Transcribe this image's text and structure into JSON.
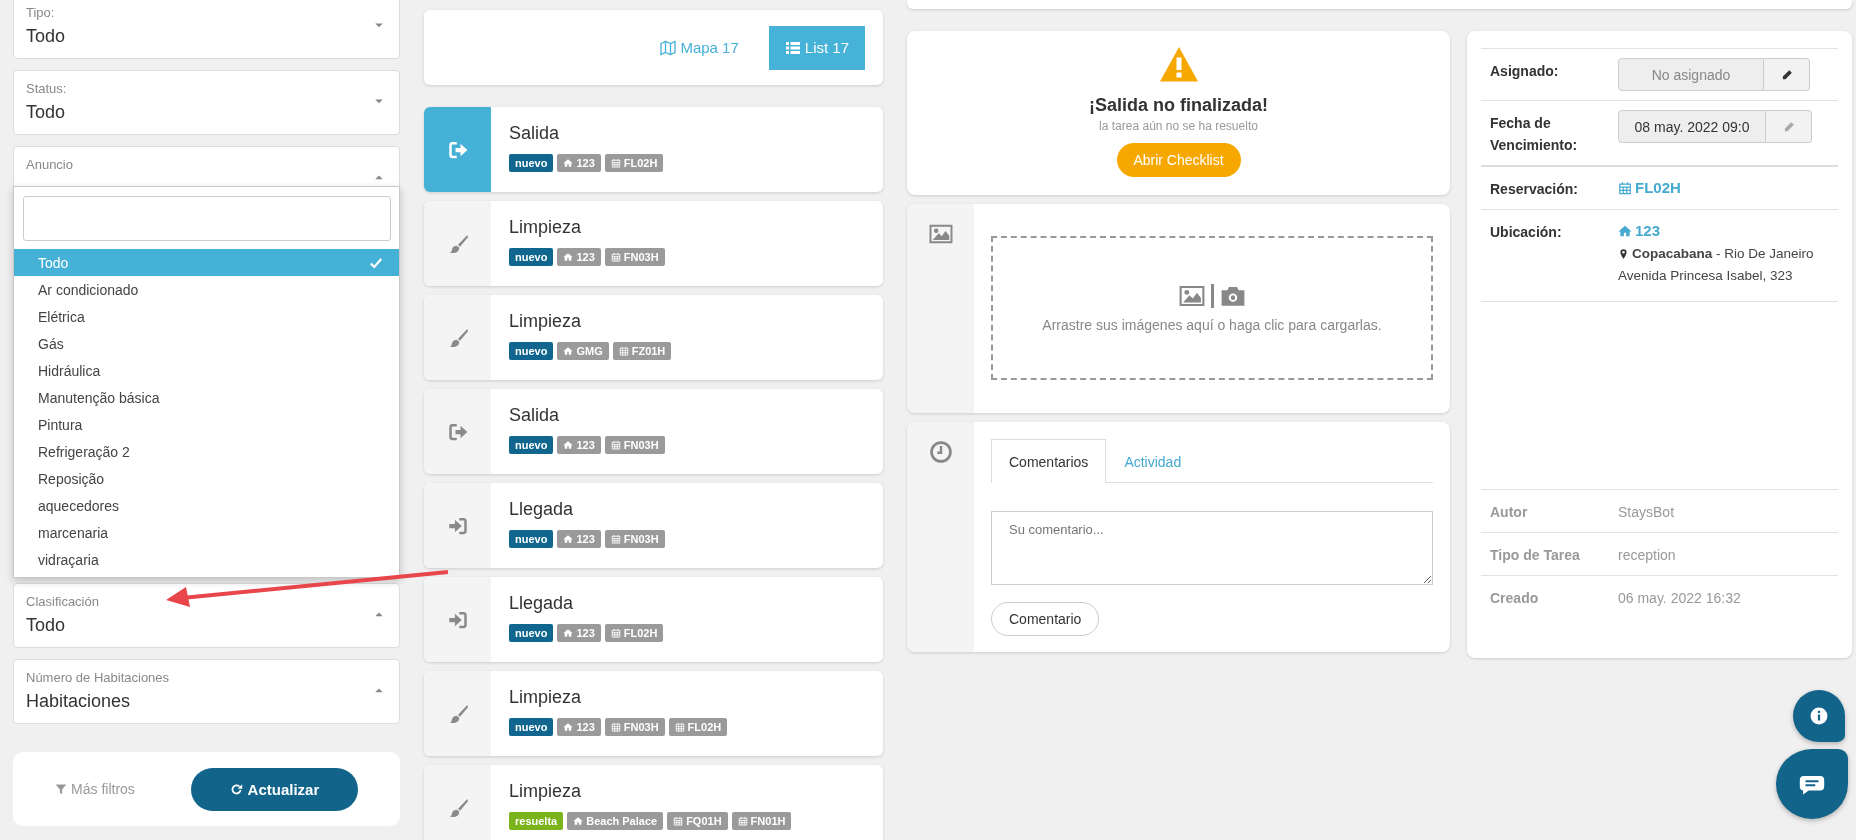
{
  "filters": [
    {
      "label": "Tipo:",
      "value": "Todo",
      "caret_up": false
    },
    {
      "label": "Status:",
      "value": "Todo",
      "caret_up": false
    },
    {
      "label": "Anuncio",
      "caret_up": true,
      "open": true,
      "dropdown": {
        "options": [
          {
            "label": "Todo",
            "selected": true
          },
          {
            "label": "Ar condicionado",
            "selected": false
          },
          {
            "label": "Elétrica",
            "selected": false
          },
          {
            "label": "Gás",
            "selected": false
          },
          {
            "label": "Hidráulica",
            "selected": false
          },
          {
            "label": "Manutenção básica",
            "selected": false
          },
          {
            "label": "Pintura",
            "selected": false
          },
          {
            "label": "Refrigeração 2",
            "selected": false
          },
          {
            "label": "Reposição",
            "selected": false
          },
          {
            "label": "aquecedores",
            "selected": false
          },
          {
            "label": "marcenaria",
            "selected": false
          },
          {
            "label": "vidraçaria",
            "selected": false
          }
        ]
      }
    },
    {
      "label": "Clasificación",
      "value": "Todo",
      "caret_up": true
    },
    {
      "label": "Número de Habitaciones",
      "value": "Habitaciones",
      "caret_up": true
    }
  ],
  "filter_actions": {
    "more_filters": "Más filtros",
    "refresh": "Actualizar"
  },
  "view_toggle": [
    {
      "kind": "map",
      "label": "Mapa 17",
      "selected": false
    },
    {
      "kind": "list",
      "label": "List 17",
      "selected": true
    }
  ],
  "tasks": [
    {
      "kind": "checkout",
      "title": "Salida",
      "selected": true,
      "tags": [
        {
          "kind": "status",
          "text": "nuevo",
          "color": "#10668f"
        },
        {
          "kind": "property",
          "text": "123"
        },
        {
          "kind": "booking",
          "text": "FL02H"
        }
      ]
    },
    {
      "kind": "cleaning",
      "title": "Limpieza",
      "selected": false,
      "tags": [
        {
          "kind": "status",
          "text": "nuevo",
          "color": "#10668f"
        },
        {
          "kind": "property",
          "text": "123"
        },
        {
          "kind": "booking",
          "text": "FN03H"
        }
      ]
    },
    {
      "kind": "cleaning",
      "title": "Limpieza",
      "selected": false,
      "tags": [
        {
          "kind": "status",
          "text": "nuevo",
          "color": "#10668f"
        },
        {
          "kind": "property",
          "text": "GMG"
        },
        {
          "kind": "booking",
          "text": "FZ01H"
        }
      ]
    },
    {
      "kind": "checkout",
      "title": "Salida",
      "selected": false,
      "tags": [
        {
          "kind": "status",
          "text": "nuevo",
          "color": "#10668f"
        },
        {
          "kind": "property",
          "text": "123"
        },
        {
          "kind": "booking",
          "text": "FN03H"
        }
      ]
    },
    {
      "kind": "checkin",
      "title": "Llegada",
      "selected": false,
      "tags": [
        {
          "kind": "status",
          "text": "nuevo",
          "color": "#10668f"
        },
        {
          "kind": "property",
          "text": "123"
        },
        {
          "kind": "booking",
          "text": "FN03H"
        }
      ]
    },
    {
      "kind": "checkin",
      "title": "Llegada",
      "selected": false,
      "tags": [
        {
          "kind": "status",
          "text": "nuevo",
          "color": "#10668f"
        },
        {
          "kind": "property",
          "text": "123"
        },
        {
          "kind": "booking",
          "text": "FL02H"
        }
      ]
    },
    {
      "kind": "cleaning",
      "title": "Limpieza",
      "selected": false,
      "tags": [
        {
          "kind": "status",
          "text": "nuevo",
          "color": "#10668f"
        },
        {
          "kind": "property",
          "text": "123"
        },
        {
          "kind": "booking",
          "text": "FN03H"
        },
        {
          "kind": "booking",
          "text": "FL02H"
        }
      ]
    },
    {
      "kind": "cleaning",
      "title": "Limpieza",
      "selected": false,
      "tags": [
        {
          "kind": "status",
          "text": "resuelta",
          "color": "#7bb31a"
        },
        {
          "kind": "property",
          "text": "Beach Palace"
        },
        {
          "kind": "booking",
          "text": "FQ01H"
        },
        {
          "kind": "booking",
          "text": "FN01H"
        }
      ]
    }
  ],
  "warning": {
    "title": "¡Salida no finalizada!",
    "subtitle": "la tarea aún no se ha resuelto",
    "button": "Abrir Checklist"
  },
  "upload": {
    "text": "Arrastre sus imágenes aquí o haga clic para cargarlas."
  },
  "comments": {
    "tabs": [
      {
        "label": "Comentarios",
        "selected": true
      },
      {
        "label": "Actividad",
        "selected": false
      }
    ],
    "placeholder": "Su comentario...",
    "button": "Comentario"
  },
  "details": {
    "rows": [
      {
        "kind": "field",
        "label": "Asignado:",
        "placeholder": "No asignado",
        "edit_disabled": false
      },
      {
        "kind": "field",
        "label": "Fecha de Vencimiento:",
        "value": "08 may. 2022 09:0",
        "edit_disabled": true
      },
      {
        "kind": "link",
        "label": "Reservación:",
        "value": "FL02H"
      },
      {
        "kind": "location",
        "label": "Ubicación:",
        "value": "123",
        "address": [
          "**Copacabana** - Rio De Janeiro",
          "Avenida Princesa Isabel, 323"
        ]
      }
    ],
    "meta": [
      {
        "label": "Autor",
        "value": "StaysBot"
      },
      {
        "label": "Tipo de Tarea",
        "value": "reception"
      },
      {
        "label": "Creado",
        "value": "06 may. 2022 16:32"
      }
    ]
  }
}
